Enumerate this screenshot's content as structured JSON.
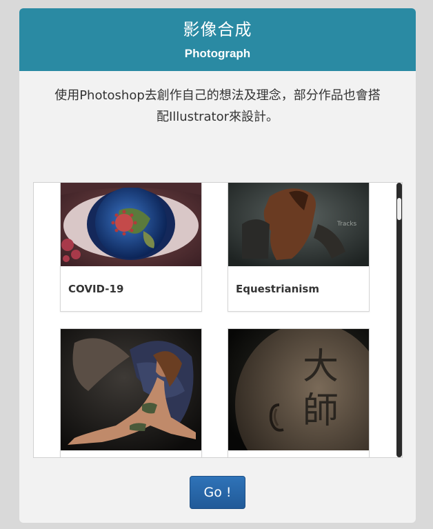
{
  "header": {
    "title": "影像合成",
    "subtitle": "Photograph"
  },
  "description": {
    "line1": "使用Photoshop去創作自己的想法及理念，部分作品也會搭",
    "line2": "配Illustrator來設計。"
  },
  "gallery": {
    "items": [
      {
        "label": "COVID-19",
        "icon": "eye-globe-image"
      },
      {
        "label": "Equestrianism",
        "icon": "horse-image"
      },
      {
        "label": "",
        "icon": "woman-wings-image"
      },
      {
        "label": "",
        "icon": "bald-head-calligraphy-image"
      }
    ],
    "calligraphy": "大師"
  },
  "go_button": {
    "label": "Go !"
  },
  "colors": {
    "header_bg": "#2a8aa3",
    "card_bg": "#f2f2f2",
    "button_bg": "#2a66a8"
  }
}
